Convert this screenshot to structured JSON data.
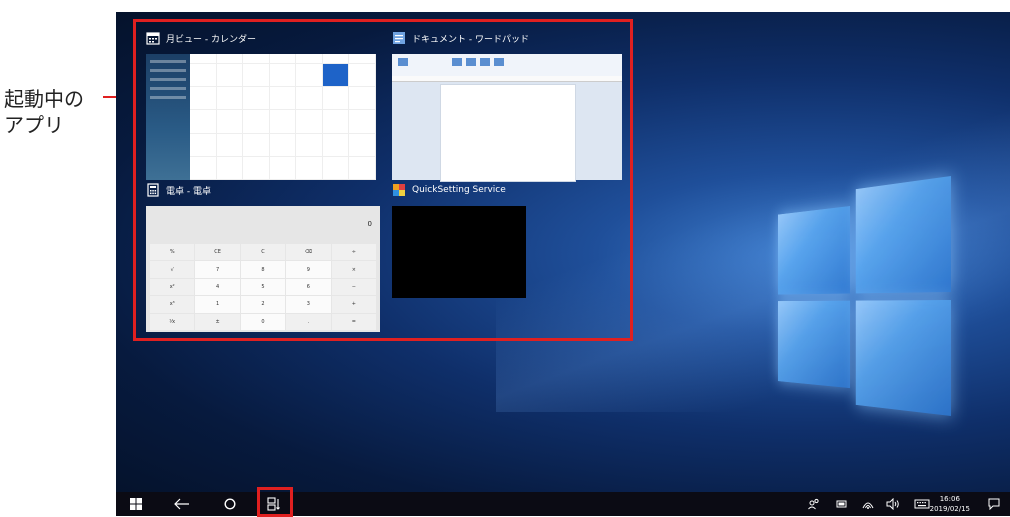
{
  "callout": {
    "line1": "起動中の",
    "line2": "アプリ"
  },
  "apps": [
    {
      "title": "月ビュー - カレンダー",
      "icon": "calendar-icon"
    },
    {
      "title": "ドキュメント - ワードパッド",
      "icon": "wordpad-icon"
    },
    {
      "title": "電卓 - 電卓",
      "icon": "calculator-icon"
    },
    {
      "title": "QuickSetting Service",
      "icon": "quicksetting-icon"
    }
  ],
  "calculator": {
    "display": "0"
  },
  "taskbar": {
    "start": "windows-start-icon",
    "back": "back-arrow-icon",
    "home": "home-circle-icon",
    "task_view": "task-view-icon",
    "time": "16:06",
    "date": "2019/02/15"
  },
  "colors": {
    "accent_red": "#e02020",
    "taskbar": "#0b0b14"
  }
}
